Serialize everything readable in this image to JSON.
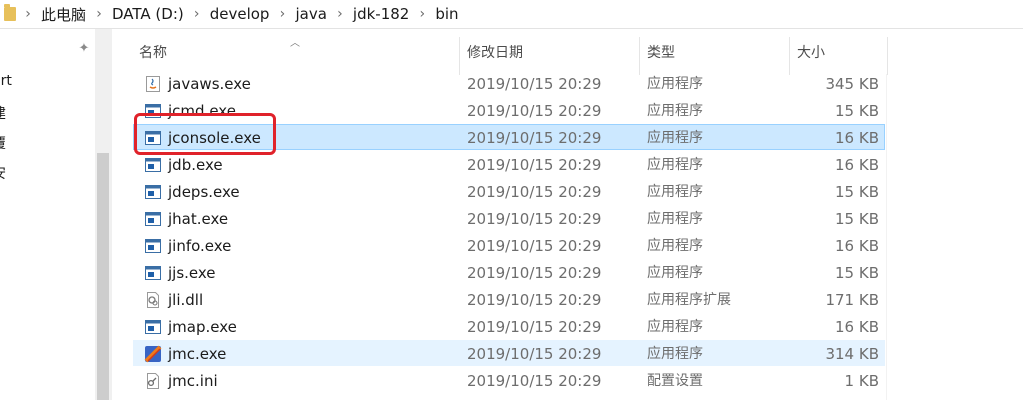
{
  "breadcrumb": [
    "此电脑",
    "DATA (D:)",
    "develop",
    "java",
    "jdk-182",
    "bin"
  ],
  "nav": {
    "items": [
      "art",
      "建",
      "覆",
      "安"
    ]
  },
  "columns": {
    "name": "名称",
    "date": "修改日期",
    "type": "类型",
    "size": "大小"
  },
  "files": [
    {
      "name": "javaws.exe",
      "date": "2019/10/15 20:29",
      "type": "应用程序",
      "size": "345 KB",
      "icon": "java-app-icon"
    },
    {
      "name": "jcmd.exe",
      "date": "2019/10/15 20:29",
      "type": "应用程序",
      "size": "15 KB",
      "icon": "exe-icon"
    },
    {
      "name": "jconsole.exe",
      "date": "2019/10/15 20:29",
      "type": "应用程序",
      "size": "16 KB",
      "icon": "exe-icon"
    },
    {
      "name": "jdb.exe",
      "date": "2019/10/15 20:29",
      "type": "应用程序",
      "size": "16 KB",
      "icon": "exe-icon"
    },
    {
      "name": "jdeps.exe",
      "date": "2019/10/15 20:29",
      "type": "应用程序",
      "size": "15 KB",
      "icon": "exe-icon"
    },
    {
      "name": "jhat.exe",
      "date": "2019/10/15 20:29",
      "type": "应用程序",
      "size": "15 KB",
      "icon": "exe-icon"
    },
    {
      "name": "jinfo.exe",
      "date": "2019/10/15 20:29",
      "type": "应用程序",
      "size": "16 KB",
      "icon": "exe-icon"
    },
    {
      "name": "jjs.exe",
      "date": "2019/10/15 20:29",
      "type": "应用程序",
      "size": "15 KB",
      "icon": "exe-icon"
    },
    {
      "name": "jli.dll",
      "date": "2019/10/15 20:29",
      "type": "应用程序扩展",
      "size": "171 KB",
      "icon": "dll-icon"
    },
    {
      "name": "jmap.exe",
      "date": "2019/10/15 20:29",
      "type": "应用程序",
      "size": "16 KB",
      "icon": "exe-icon"
    },
    {
      "name": "jmc.exe",
      "date": "2019/10/15 20:29",
      "type": "应用程序",
      "size": "314 KB",
      "icon": "jmc-app-icon"
    },
    {
      "name": "jmc.ini",
      "date": "2019/10/15 20:29",
      "type": "配置设置",
      "size": "1 KB",
      "icon": "ini-file-icon"
    }
  ],
  "selected_file": "jconsole.exe",
  "hovered_file": "jmc.exe",
  "colors": {
    "selection_bg": "#cce8ff",
    "hover_bg": "#e5f3ff",
    "annotation_red": "#e0222a"
  }
}
